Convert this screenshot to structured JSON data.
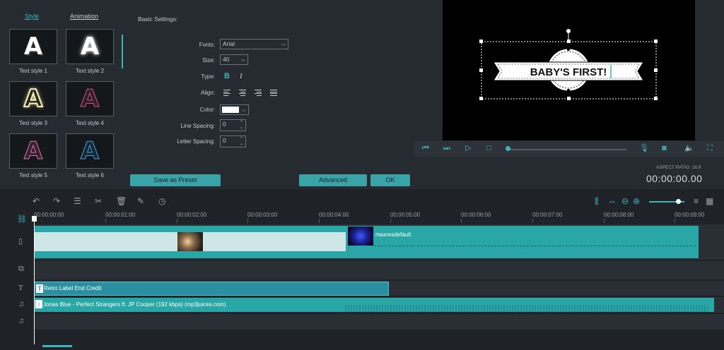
{
  "tabs": {
    "style": "Style",
    "animation": "Animation"
  },
  "text_styles": [
    {
      "label": "Text style 1",
      "glyph": "A",
      "color": "#ffffff"
    },
    {
      "label": "Text style 2",
      "glyph": "A",
      "color": "#ffffff"
    },
    {
      "label": "Text style 3",
      "glyph": "A",
      "color": "#f5f0c0"
    },
    {
      "label": "Text style 4",
      "glyph": "A",
      "color": "#6a2c4e"
    },
    {
      "label": "Text style 5",
      "glyph": "A",
      "color": "#4a2a3c"
    },
    {
      "label": "Text style 6",
      "glyph": "A",
      "color": "#1c3a55"
    }
  ],
  "basic_settings": {
    "heading": "Basic Settings:",
    "fonts_label": "Fonts:",
    "fonts_value": "Arial",
    "size_label": "Size:",
    "size_value": "40",
    "type_label": "Type:",
    "bold": "B",
    "italic": "I",
    "align_label": "Align:",
    "color_label": "Color:",
    "color_value": "#ffffff",
    "line_spacing_label": "Line Spacing:",
    "line_spacing_value": "0",
    "letter_spacing_label": "Letter Spacing:",
    "letter_spacing_value": "0"
  },
  "buttons": {
    "save_preset": "Save as Preset",
    "advanced": "Advanced",
    "ok": "OK"
  },
  "preview": {
    "title_text": "BABY'S FIRST!",
    "aspect_ratio": "ASPECT RATIO: 16:9",
    "timecode": "00:00:00.00",
    "progress": 0
  },
  "timeline": {
    "ruler": [
      "00:00:00:00",
      "00:00:01:00",
      "00:00:02:00",
      "00:00:03:00",
      "00:00:04:00",
      "00:00:05:00",
      "00:00:06:00",
      "00:00:07:00",
      "00:00:08:00",
      "00:00:09:00"
    ],
    "video_clip_label": "maxresdefault",
    "title_clip_label": "Retro Label End Credit",
    "audio_clip_label": "Jonas Blue - Perfect Strangers ft. JP Cooper (192  kbps) (mp3juices.com)",
    "accent": "#2aa6a6"
  }
}
